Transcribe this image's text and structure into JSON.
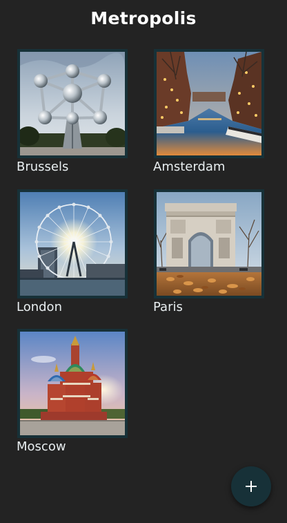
{
  "app": {
    "title": "Metropolis"
  },
  "cities": [
    {
      "name": "Brussels"
    },
    {
      "name": "Amsterdam"
    },
    {
      "name": "London"
    },
    {
      "name": "Paris"
    },
    {
      "name": "Moscow"
    }
  ],
  "fab": {
    "icon": "plus-icon"
  },
  "colors": {
    "background": "#232323",
    "card_border": "#173138",
    "fab": "#173138",
    "text": "#e8eef0"
  }
}
